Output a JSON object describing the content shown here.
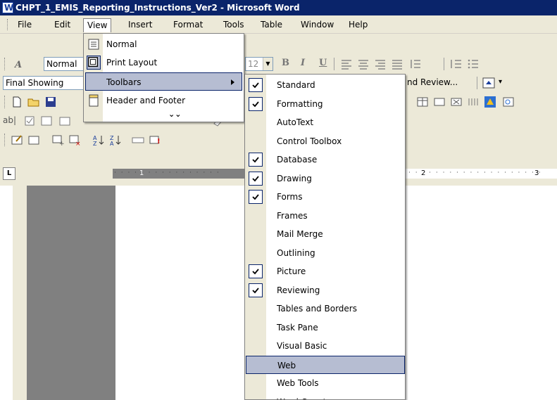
{
  "window": {
    "title": "CHPT_1_EMIS_Reporting_Instructions_Ver2 - Microsoft Word"
  },
  "menubar": {
    "items": [
      {
        "label": "File"
      },
      {
        "label": "Edit"
      },
      {
        "label": "View"
      },
      {
        "label": "Insert"
      },
      {
        "label": "Format"
      },
      {
        "label": "Tools"
      },
      {
        "label": "Table"
      },
      {
        "label": "Window"
      },
      {
        "label": "Help"
      }
    ]
  },
  "formatting_toolbar": {
    "style_value": "Normal",
    "size_value": "12",
    "bold": "B",
    "italic": "I",
    "underline": "U"
  },
  "reviewing_toolbar": {
    "display_value": "Final Showing",
    "review_label": "nd Review..."
  },
  "ruler": {
    "numbers": [
      "1",
      "2",
      "3"
    ],
    "tab_glyph": "L"
  },
  "view_menu": {
    "items": [
      {
        "label": "Normal",
        "icon": "normal-view-icon"
      },
      {
        "label": "Print Layout",
        "icon": "print-layout-icon"
      },
      {
        "label": "Toolbars",
        "icon": "",
        "submenu": true,
        "highlighted": true
      },
      {
        "label": "Header and Footer",
        "icon": "header-footer-icon"
      }
    ],
    "expand_glyph": "⌄⌄"
  },
  "toolbars_submenu": {
    "items": [
      {
        "label": "Standard",
        "checked": true
      },
      {
        "label": "Formatting",
        "checked": true
      },
      {
        "label": "AutoText",
        "checked": false
      },
      {
        "label": "Control Toolbox",
        "checked": false
      },
      {
        "label": "Database",
        "checked": true
      },
      {
        "label": "Drawing",
        "checked": true
      },
      {
        "label": "Forms",
        "checked": true
      },
      {
        "label": "Frames",
        "checked": false
      },
      {
        "label": "Mail Merge",
        "checked": false
      },
      {
        "label": "Outlining",
        "checked": false
      },
      {
        "label": "Picture",
        "checked": true
      },
      {
        "label": "Reviewing",
        "checked": true
      },
      {
        "label": "Tables and Borders",
        "checked": false
      },
      {
        "label": "Task Pane",
        "checked": false
      },
      {
        "label": "Visual Basic",
        "checked": false
      },
      {
        "label": "Web",
        "checked": false,
        "highlighted": true
      },
      {
        "label": "Web Tools",
        "checked": false
      },
      {
        "label": "Word Count",
        "checked": false
      }
    ]
  },
  "colors": {
    "titlebar": "#0a246a",
    "menu_highlight": "#b6bdd2",
    "chrome": "#ece9d8"
  }
}
